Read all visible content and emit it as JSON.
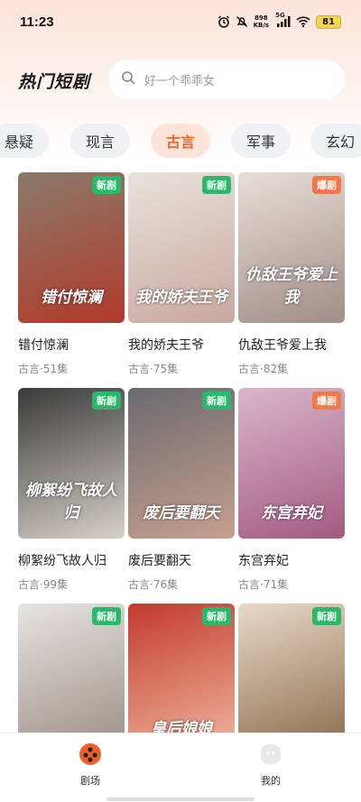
{
  "status_bar": {
    "time": "11:23",
    "net_speed_value": "898",
    "net_speed_unit": "KB/s",
    "signal_label": "5G",
    "battery": "81",
    "icons": [
      "alarm-icon",
      "mute-icon",
      "signal-icon",
      "wifi-icon",
      "battery-icon"
    ]
  },
  "header": {
    "title": "热门短剧",
    "search_placeholder": "好一个乖乖女"
  },
  "tabs": [
    {
      "label": "悬疑",
      "active": false
    },
    {
      "label": "现言",
      "active": false
    },
    {
      "label": "古言",
      "active": true
    },
    {
      "label": "军事",
      "active": false
    },
    {
      "label": "玄幻",
      "active": false
    }
  ],
  "dramas": [
    {
      "name": "错付惊澜",
      "genre": "古言",
      "episodes": "51集",
      "badge": "新剧",
      "badge_type": "new",
      "poster_text": "错付惊澜",
      "colors": [
        "#8a7a6a",
        "#b23a2a"
      ]
    },
    {
      "name": "我的娇夫王爷",
      "genre": "古言",
      "episodes": "75集",
      "badge": "新剧",
      "badge_type": "new",
      "poster_text": "我的娇夫王爷",
      "colors": [
        "#e9e2dc",
        "#c9a8a0"
      ]
    },
    {
      "name": "仇敌王爷爱上我",
      "genre": "古言",
      "episodes": "82集",
      "badge": "爆剧",
      "badge_type": "hot",
      "poster_text": "仇敌王爷爱上我",
      "colors": [
        "#e8dfd8",
        "#a08d86"
      ]
    },
    {
      "name": "柳絮纷飞故人归",
      "genre": "古言",
      "episodes": "99集",
      "badge": "新剧",
      "badge_type": "new",
      "poster_text": "柳絮纷飞故人归",
      "colors": [
        "#3a3a3a",
        "#d6d0c8"
      ]
    },
    {
      "name": "废后要翻天",
      "genre": "古言",
      "episodes": "76集",
      "badge": "新剧",
      "badge_type": "new",
      "poster_text": "废后要翻天",
      "colors": [
        "#6b6a70",
        "#c7a08e"
      ]
    },
    {
      "name": "东宫弃妃",
      "genre": "古言",
      "episodes": "71集",
      "badge": "爆剧",
      "badge_type": "hot",
      "poster_text": "东宫弃妃",
      "colors": [
        "#d9b7c8",
        "#a35a82"
      ]
    },
    {
      "name": "",
      "genre": "",
      "episodes": "",
      "badge": "新剧",
      "badge_type": "new",
      "poster_text": "",
      "colors": [
        "#e6e4e2",
        "#9c8d84"
      ]
    },
    {
      "name": "",
      "genre": "",
      "episodes": "",
      "badge": "新剧",
      "badge_type": "new",
      "poster_text": "皇后娘娘",
      "colors": [
        "#c23a2e",
        "#f0b8a0"
      ]
    },
    {
      "name": "",
      "genre": "",
      "episodes": "",
      "badge": "新剧",
      "badge_type": "new",
      "poster_text": "",
      "colors": [
        "#e8d9c8",
        "#8a6a4a"
      ]
    }
  ],
  "bottom_nav": [
    {
      "label": "剧场",
      "icon": "theater-icon",
      "active": true
    },
    {
      "label": "我的",
      "icon": "profile-icon",
      "active": false
    }
  ]
}
